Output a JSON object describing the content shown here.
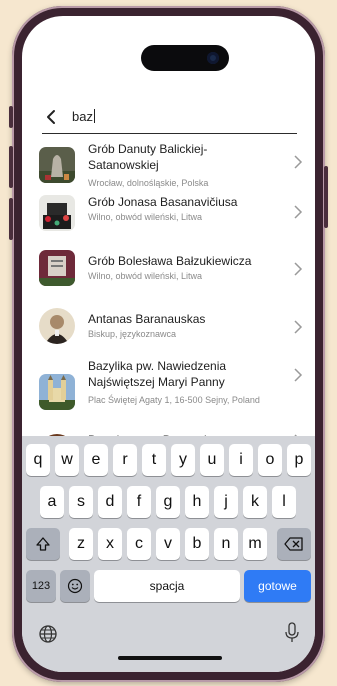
{
  "search": {
    "query": "baz"
  },
  "results": [
    {
      "title": "Grób Danuty Balickiej-Satanowskiej",
      "subtitle": "Wrocław, dolnośląskie, Polska",
      "thumb": "grave-monument"
    },
    {
      "title": "Grób Jonasa Basanavičiusa",
      "subtitle": "Wilno, obwód wileński, Litwa",
      "thumb": "grave-with-flowers"
    },
    {
      "title": "Grób Bolesława Bałzukiewicza",
      "subtitle": "Wilno, obwód wileński, Litwa",
      "thumb": "grave-plaque"
    },
    {
      "title": "Antanas Baranauskas",
      "subtitle": "Biskup, językoznawca",
      "thumb": "portrait"
    },
    {
      "title": "Bazylika pw. Nawiedzenia Najświętszej Maryi Panny",
      "subtitle": "Plac Świętej Agaty 1, 16-500 Sejny, Poland",
      "thumb": "basilica"
    },
    {
      "title": "Bartolommeo Berrecci",
      "subtitle": "",
      "thumb": "portrait-painting"
    }
  ],
  "keyboard": {
    "row1": [
      "q",
      "w",
      "e",
      "r",
      "t",
      "y",
      "u",
      "i",
      "o",
      "p"
    ],
    "row2": [
      "a",
      "s",
      "d",
      "f",
      "g",
      "h",
      "j",
      "k",
      "l"
    ],
    "row3": [
      "z",
      "x",
      "c",
      "v",
      "b",
      "n",
      "m"
    ],
    "numbers_label": "123",
    "space_label": "spacja",
    "return_label": "gotowe"
  },
  "colors": {
    "accent": "#2f7bf5",
    "frame": "#3b2330",
    "background": "#f6e7cf"
  }
}
